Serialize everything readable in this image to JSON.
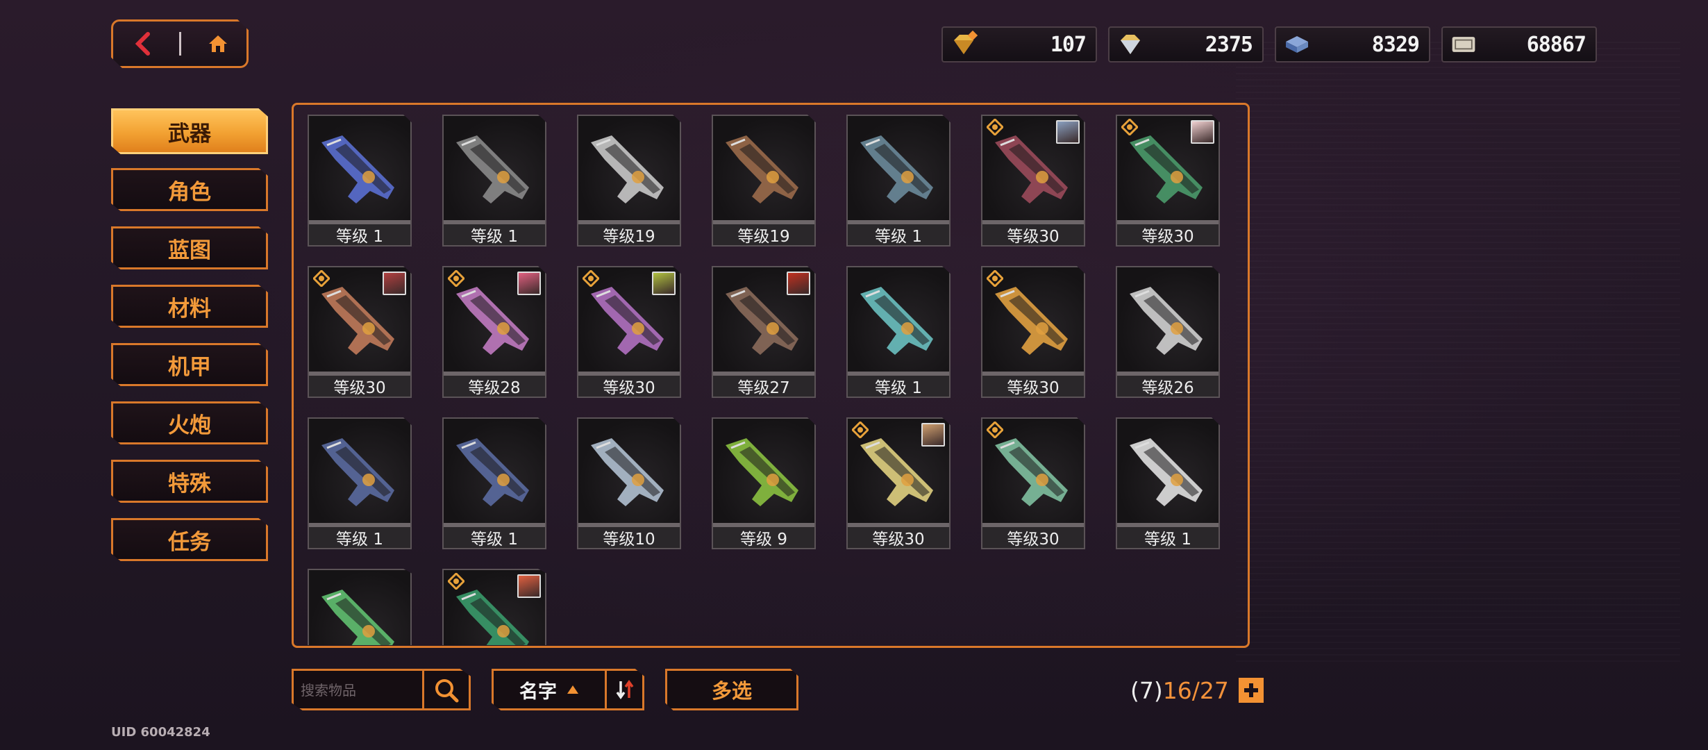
{
  "currencies": [
    {
      "icon": "diamond-premium-icon",
      "value": "107"
    },
    {
      "icon": "diamond-icon",
      "value": "2375"
    },
    {
      "icon": "blueprint-chip-icon",
      "value": "8329"
    },
    {
      "icon": "ticket-icon",
      "value": "68867"
    }
  ],
  "tabs": [
    {
      "label": "武器",
      "active": true
    },
    {
      "label": "角色",
      "active": false
    },
    {
      "label": "蓝图",
      "active": false
    },
    {
      "label": "材料",
      "active": false
    },
    {
      "label": "机甲",
      "active": false
    },
    {
      "label": "火炮",
      "active": false
    },
    {
      "label": "特殊",
      "active": false
    },
    {
      "label": "任务",
      "active": false
    }
  ],
  "items": [
    {
      "level": "等级 1",
      "color": "#5a6fd0",
      "rank": false,
      "portrait": ""
    },
    {
      "level": "等级 1",
      "color": "#8a8a8a",
      "rank": false,
      "portrait": ""
    },
    {
      "level": "等级19",
      "color": "#c8c8c8",
      "rank": false,
      "portrait": ""
    },
    {
      "level": "等级19",
      "color": "#9a6a4a",
      "rank": false,
      "portrait": ""
    },
    {
      "level": "等级 1",
      "color": "#6a8a9a",
      "rank": false,
      "portrait": ""
    },
    {
      "level": "等级30",
      "color": "#9a4a5a",
      "rank": true,
      "portrait": "#8aa0c0"
    },
    {
      "level": "等级30",
      "color": "#4a9a6a",
      "rank": true,
      "portrait": "#f0d0d0"
    },
    {
      "level": "等级30",
      "color": "#c07a5a",
      "rank": true,
      "portrait": "#b04040"
    },
    {
      "level": "等级28",
      "color": "#c07ac0",
      "rank": true,
      "portrait": "#e06080"
    },
    {
      "level": "等级30",
      "color": "#b070c0",
      "rank": true,
      "portrait": "#b0c040"
    },
    {
      "level": "等级27",
      "color": "#8a6a5a",
      "rank": false,
      "portrait": "#c03020"
    },
    {
      "level": "等级 1",
      "color": "#6ac0c0",
      "rank": false,
      "portrait": ""
    },
    {
      "level": "等级30",
      "color": "#e0a040",
      "rank": true,
      "portrait": ""
    },
    {
      "level": "等级26",
      "color": "#d0d0d0",
      "rank": false,
      "portrait": ""
    },
    {
      "level": "等级 1",
      "color": "#5a6aa0",
      "rank": false,
      "portrait": ""
    },
    {
      "level": "等级 1",
      "color": "#5a6aa0",
      "rank": false,
      "portrait": ""
    },
    {
      "level": "等级10",
      "color": "#b0c0d0",
      "rank": false,
      "portrait": ""
    },
    {
      "level": "等级 9",
      "color": "#8ac040",
      "rank": false,
      "portrait": ""
    },
    {
      "level": "等级30",
      "color": "#e0d080",
      "rank": true,
      "portrait": "#d0a070"
    },
    {
      "level": "等级30",
      "color": "#80c0a0",
      "rank": true,
      "portrait": ""
    },
    {
      "level": "等级 1",
      "color": "#e0e0e0",
      "rank": false,
      "portrait": ""
    },
    {
      "level": "",
      "color": "#60c070",
      "rank": false,
      "portrait": ""
    },
    {
      "level": "",
      "color": "#3a9a6a",
      "rank": true,
      "portrait": "#e06040"
    }
  ],
  "search": {
    "placeholder": "搜索物品"
  },
  "sort": {
    "label": "名字"
  },
  "multi_select": {
    "label": "多选"
  },
  "count": {
    "prefix": "(7)",
    "current": "16/27"
  },
  "uid": "UID 60042824"
}
